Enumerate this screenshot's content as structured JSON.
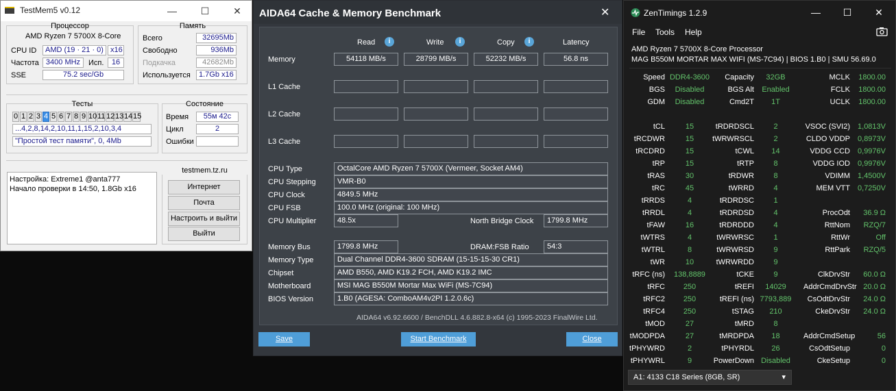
{
  "testmem": {
    "title": "TestMem5 v0.12",
    "window_controls": {
      "min": "—",
      "max": "☐",
      "close": "✕"
    },
    "cpu_group": "Процессор",
    "cpu_name": "AMD Ryzen 7 5700X 8-Core",
    "cpuid_label": "CPU ID",
    "cpuid_value": "AMD  (19 · 21 · 0)",
    "threads": "x16",
    "freq_label": "Частота",
    "freq_value": "3400 MHz",
    "isp_label": "Исп.",
    "isp_value": "16",
    "sse_label": "SSE",
    "sse_value": "75.2 sec/Gb",
    "mem_group": "Память",
    "total_label": "Всего",
    "total_value": "32695Mb",
    "free_label": "Свободно",
    "free_value": "936Mb",
    "swap_label": "Подкачка",
    "swap_value": "42682Mb",
    "used_label": "Используется",
    "used_value": "1.7Gb x16",
    "tests_group": "Тесты",
    "tests": [
      "0",
      "1",
      "2",
      "3",
      "4",
      "5",
      "6",
      "7",
      "8",
      "9",
      "10",
      "11",
      "12",
      "13",
      "14",
      "15"
    ],
    "active_test": "4",
    "sequence": "...4,2,8,14,2,10,11,1,15,2,10,3,4",
    "current_test": "\"Простой тест памяти\", 0, 4Mb",
    "state_group": "Состояние",
    "time_label": "Время",
    "time_value": "55м 42с",
    "cycle_label": "Цикл",
    "cycle_value": "2",
    "errors_label": "Ошибки",
    "errors_value": "",
    "log_line1": "Настройка: Extreme1 @anta777",
    "log_line2": "Начало проверки в 14:50, 1.8Gb x16",
    "site_group": "testmem.tz.ru",
    "btn_internet": "Интернет",
    "btn_mail": "Почта",
    "btn_setup": "Настроить и выйти",
    "btn_exit": "Выйти"
  },
  "aida": {
    "title": "AIDA64 Cache & Memory Benchmark",
    "close": "✕",
    "col_read": "Read",
    "col_write": "Write",
    "col_copy": "Copy",
    "col_latency": "Latency",
    "info_glyph": "i",
    "row_memory": "Memory",
    "row_l1": "L1 Cache",
    "row_l2": "L2 Cache",
    "row_l3": "L3 Cache",
    "mem_read": "54118 MB/s",
    "mem_write": "28799 MB/s",
    "mem_copy": "52232 MB/s",
    "mem_latency": "56.8 ns",
    "cpu_type_label": "CPU Type",
    "cpu_type": "OctalCore AMD Ryzen 7 5700X  (Vermeer, Socket AM4)",
    "cpu_stepping_label": "CPU Stepping",
    "cpu_stepping": "VMR-B0",
    "cpu_clock_label": "CPU Clock",
    "cpu_clock": "4849.5 MHz",
    "cpu_fsb_label": "CPU FSB",
    "cpu_fsb": "100.0 MHz  (original: 100 MHz)",
    "cpu_mult_label": "CPU Multiplier",
    "cpu_mult": "48.5x",
    "nb_clock_label": "North Bridge Clock",
    "nb_clock": "1799.8 MHz",
    "mem_bus_label": "Memory Bus",
    "mem_bus": "1799.8 MHz",
    "dram_fsb_label": "DRAM:FSB Ratio",
    "dram_fsb": "54:3",
    "mem_type_label": "Memory Type",
    "mem_type": "Dual Channel DDR4-3600 SDRAM  (15-15-15-30 CR1)",
    "chipset_label": "Chipset",
    "chipset": "AMD B550, AMD K19.2 FCH, AMD K19.2 IMC",
    "mb_label": "Motherboard",
    "mb": "MSI MAG B550M Mortar Max WiFi (MS-7C94)",
    "bios_label": "BIOS Version",
    "bios": "1.B0  (AGESA: ComboAM4v2PI 1.2.0.6c)",
    "footer": "AIDA64 v6.92.6600 / BenchDLL 4.6.882.8-x64  (c) 1995-2023 FinalWire Ltd.",
    "btn_save": "Save",
    "btn_start": "Start Benchmark",
    "btn_close": "Close"
  },
  "zen": {
    "title": "ZenTimings 1.2.9",
    "window_controls": {
      "min": "—",
      "max": "☐",
      "close": "✕"
    },
    "menu_file": "File",
    "menu_tools": "Tools",
    "menu_help": "Help",
    "cpu": "AMD Ryzen 7 5700X 8-Core Processor",
    "board": "MAG B550M MORTAR MAX WIFI (MS-7C94) | BIOS 1.B0 | SMU 56.69.0",
    "rows": [
      [
        "Speed",
        "DDR4-3600",
        "Capacity",
        "32GB",
        "MCLK",
        "1800.00"
      ],
      [
        "BGS",
        "Disabled",
        "BGS Alt",
        "Enabled",
        "FCLK",
        "1800.00"
      ],
      [
        "GDM",
        "Disabled",
        "Cmd2T",
        "1T",
        "UCLK",
        "1800.00"
      ],
      [
        "",
        "",
        "",
        "",
        "",
        ""
      ],
      [
        "tCL",
        "15",
        "tRDRDSCL",
        "2",
        "VSOC (SVI2)",
        "1,0813V"
      ],
      [
        "tRCDWR",
        "15",
        "tWRWRSCL",
        "2",
        "CLDO VDDP",
        "0,8973V"
      ],
      [
        "tRCDRD",
        "15",
        "tCWL",
        "14",
        "VDDG CCD",
        "0,9976V"
      ],
      [
        "tRP",
        "15",
        "tRTP",
        "8",
        "VDDG IOD",
        "0,9976V"
      ],
      [
        "tRAS",
        "30",
        "tRDWR",
        "8",
        "VDIMM",
        "1,4500V"
      ],
      [
        "tRC",
        "45",
        "tWRRD",
        "4",
        "MEM VTT",
        "0,7250V"
      ],
      [
        "tRRDS",
        "4",
        "tRDRDSC",
        "1",
        "",
        ""
      ],
      [
        "tRRDL",
        "4",
        "tRDRDSD",
        "4",
        "ProcOdt",
        "36.9 Ω"
      ],
      [
        "tFAW",
        "16",
        "tRDRDDD",
        "4",
        "RttNom",
        "RZQ/7"
      ],
      [
        "tWTRS",
        "4",
        "tWRWRSC",
        "1",
        "RttWr",
        "Off"
      ],
      [
        "tWTRL",
        "8",
        "tWRWRSD",
        "9",
        "RttPark",
        "RZQ/5"
      ],
      [
        "tWR",
        "10",
        "tWRWRDD",
        "9",
        "",
        ""
      ],
      [
        "tRFC (ns)",
        "138,8889",
        "tCKE",
        "9",
        "ClkDrvStr",
        "60.0 Ω"
      ],
      [
        "tRFC",
        "250",
        "tREFI",
        "14029",
        "AddrCmdDrvStr",
        "20.0 Ω"
      ],
      [
        "tRFC2",
        "250",
        "tREFI (ns)",
        "7793,889",
        "CsOdtDrvStr",
        "24.0 Ω"
      ],
      [
        "tRFC4",
        "250",
        "tSTAG",
        "210",
        "CkeDrvStr",
        "24.0 Ω"
      ],
      [
        "tMOD",
        "27",
        "tMRD",
        "8",
        "",
        ""
      ],
      [
        "tMODPDA",
        "27",
        "tMRDPDA",
        "18",
        "AddrCmdSetup",
        "56"
      ],
      [
        "tPHYWRD",
        "2",
        "tPHYRDL",
        "26",
        "CsOdtSetup",
        "0"
      ],
      [
        "tPHYWRL",
        "9",
        "PowerDown",
        "Disabled",
        "CkeSetup",
        "0"
      ]
    ],
    "profile": "A1: 4133 C18 Series (8GB, SR)",
    "dropdown_glyph": "▾",
    "camera_icon": "camera-icon",
    "accent": "#63c46b"
  }
}
